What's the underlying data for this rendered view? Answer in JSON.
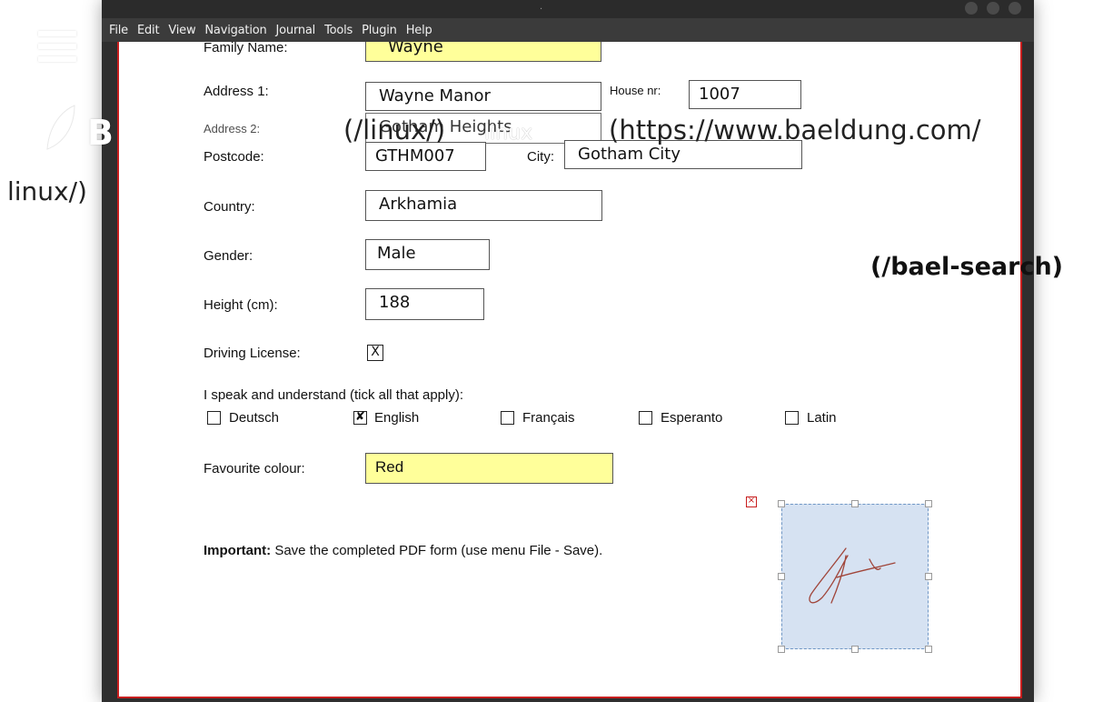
{
  "app": {
    "title_glyph": ".",
    "menu": [
      "File",
      "Edit",
      "View",
      "Navigation",
      "Journal",
      "Tools",
      "Plugin",
      "Help"
    ]
  },
  "form": {
    "family_name": {
      "label": "Family Name:",
      "value": "Wayne"
    },
    "address1": {
      "label": "Address 1:",
      "value": "Wayne Manor"
    },
    "house_nr": {
      "label": "House nr:",
      "value": "1007"
    },
    "address2": {
      "label": "Address 2:",
      "value": "Gotham Heights"
    },
    "postcode": {
      "label": "Postcode:",
      "value": "GTHM007"
    },
    "city": {
      "label": "City:",
      "value": "Gotham City"
    },
    "country": {
      "label": "Country:",
      "value": "Arkhamia"
    },
    "gender": {
      "label": "Gender:",
      "value": "Male"
    },
    "height": {
      "label": "Height (cm):",
      "value": "188"
    },
    "driving_license": {
      "label": "Driving License:",
      "value": "X"
    },
    "languages": {
      "label": "I speak and understand (tick all that apply):",
      "options": [
        {
          "label": "Deutsch",
          "checked": false
        },
        {
          "label": "English",
          "checked": true
        },
        {
          "label": "Français",
          "checked": false
        },
        {
          "label": "Esperanto",
          "checked": false
        },
        {
          "label": "Latin",
          "checked": false
        }
      ]
    },
    "favourite_colour": {
      "label": "Favourite colour:",
      "value": "Red"
    },
    "note": {
      "bold": "Important:",
      "text": " Save the completed PDF form (use menu File - Save)."
    }
  },
  "signature": {
    "delete_icon": "close-icon",
    "color": "#a0453a",
    "fill": "#d6e2f2"
  },
  "overlay": {
    "logo_letter": "B",
    "link_linux": "(/linux/)",
    "link_linux_text": "linux",
    "link_url": "(https://www.baeldung.com/",
    "link_url_cont": "linux/)",
    "link_search": "(/bael-search)"
  },
  "colors": {
    "page_border": "#c81e1e",
    "yellow_field": "#ffff9a",
    "menubar": "#3b3b3b"
  }
}
